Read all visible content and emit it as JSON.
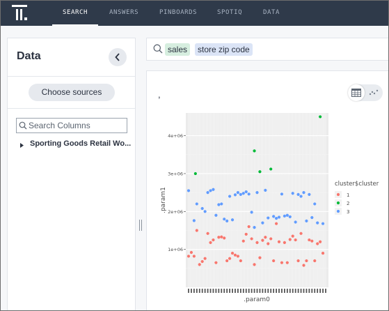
{
  "nav": {
    "items": [
      {
        "label": "SEARCH",
        "active": true
      },
      {
        "label": "ANSWERS",
        "active": false
      },
      {
        "label": "PINBOARDS",
        "active": false
      },
      {
        "label": "SPOTIQ",
        "active": false
      },
      {
        "label": "DATA",
        "active": false
      }
    ]
  },
  "left_panel": {
    "title": "Data",
    "choose_sources_label": "Choose sources",
    "search_placeholder": "Search Columns",
    "source_name": "Sporting Goods Retail Wo..."
  },
  "search": {
    "tokens": [
      {
        "label": "sales",
        "kind": "measure"
      },
      {
        "label": "store zip code",
        "kind": "attribute"
      }
    ]
  },
  "answer": {
    "title": ","
  },
  "colors": {
    "nav_bg": "#2f3a4a",
    "cluster_1": "#f8766d",
    "cluster_2": "#00ba38",
    "cluster_3": "#619cff",
    "token_measure": "#d6eedf",
    "token_attribute": "#dbe4f6"
  },
  "chart_data": {
    "type": "scatter",
    "xlabel": ".param0",
    "ylabel": ".param1",
    "ylim": [
      0,
      4600000
    ],
    "y_ticks": [
      {
        "value": 1000000,
        "label": "1e+06"
      },
      {
        "value": 2000000,
        "label": "2e+06"
      },
      {
        "value": 3000000,
        "label": "3e+06"
      },
      {
        "value": 4000000,
        "label": "4e+06"
      }
    ],
    "x_ticks_note": "100…",
    "grid": true,
    "legend": {
      "title": "cluster$cluster",
      "position": "right",
      "entries": [
        "1",
        "2",
        "3"
      ]
    },
    "x_domain": [
      0,
      100
    ],
    "series": [
      {
        "name": "1",
        "points": [
          [
            0,
            820000
          ],
          [
            2,
            920000
          ],
          [
            4,
            820000
          ],
          [
            6,
            1500000
          ],
          [
            8,
            600000
          ],
          [
            10,
            680000
          ],
          [
            12,
            760000
          ],
          [
            14,
            1420000
          ],
          [
            16,
            1180000
          ],
          [
            18,
            1250000
          ],
          [
            20,
            650000
          ],
          [
            22,
            1320000
          ],
          [
            24,
            1330000
          ],
          [
            26,
            1300000
          ],
          [
            28,
            700000
          ],
          [
            30,
            760000
          ],
          [
            32,
            900000
          ],
          [
            34,
            850000
          ],
          [
            36,
            820000
          ],
          [
            38,
            700000
          ],
          [
            40,
            1220000
          ],
          [
            42,
            1400000
          ],
          [
            44,
            1600000
          ],
          [
            46,
            1280000
          ],
          [
            48,
            600000
          ],
          [
            50,
            1180000
          ],
          [
            52,
            780000
          ],
          [
            54,
            1240000
          ],
          [
            56,
            1320000
          ],
          [
            58,
            1150000
          ],
          [
            60,
            1280000
          ],
          [
            62,
            700000
          ],
          [
            64,
            1680000
          ],
          [
            66,
            1200000
          ],
          [
            68,
            650000
          ],
          [
            70,
            1180000
          ],
          [
            72,
            650000
          ],
          [
            74,
            1260000
          ],
          [
            76,
            1350000
          ],
          [
            78,
            1250000
          ],
          [
            80,
            700000
          ],
          [
            82,
            1420000
          ],
          [
            84,
            580000
          ],
          [
            86,
            700000
          ],
          [
            88,
            1250000
          ],
          [
            90,
            1220000
          ],
          [
            92,
            700000
          ],
          [
            94,
            1150000
          ],
          [
            96,
            1200000
          ],
          [
            98,
            900000
          ]
        ]
      },
      {
        "name": "2",
        "points": [
          [
            5,
            3000000
          ],
          [
            48,
            3600000
          ],
          [
            52,
            3050000
          ],
          [
            60,
            3120000
          ],
          [
            96,
            4500000
          ]
        ]
      },
      {
        "name": "3",
        "points": [
          [
            0,
            2550000
          ],
          [
            4,
            1760000
          ],
          [
            6,
            2200000
          ],
          [
            10,
            2080000
          ],
          [
            12,
            2000000
          ],
          [
            14,
            2500000
          ],
          [
            16,
            2550000
          ],
          [
            18,
            2580000
          ],
          [
            20,
            1900000
          ],
          [
            22,
            2180000
          ],
          [
            24,
            2200000
          ],
          [
            26,
            1800000
          ],
          [
            28,
            1750000
          ],
          [
            30,
            2400000
          ],
          [
            32,
            1780000
          ],
          [
            34,
            2440000
          ],
          [
            36,
            2500000
          ],
          [
            38,
            2450000
          ],
          [
            40,
            2480000
          ],
          [
            42,
            2520000
          ],
          [
            44,
            2460000
          ],
          [
            46,
            1980000
          ],
          [
            48,
            1580000
          ],
          [
            50,
            2500000
          ],
          [
            54,
            1700000
          ],
          [
            56,
            2560000
          ],
          [
            58,
            1830000
          ],
          [
            62,
            1870000
          ],
          [
            64,
            1820000
          ],
          [
            66,
            1850000
          ],
          [
            68,
            2460000
          ],
          [
            70,
            1880000
          ],
          [
            72,
            1900000
          ],
          [
            74,
            1860000
          ],
          [
            76,
            2480000
          ],
          [
            78,
            1720000
          ],
          [
            80,
            2450000
          ],
          [
            82,
            2400000
          ],
          [
            84,
            2500000
          ],
          [
            86,
            1750000
          ],
          [
            88,
            2450000
          ],
          [
            90,
            1840000
          ],
          [
            92,
            2200000
          ],
          [
            94,
            1700000
          ],
          [
            98,
            1680000
          ]
        ]
      }
    ]
  }
}
